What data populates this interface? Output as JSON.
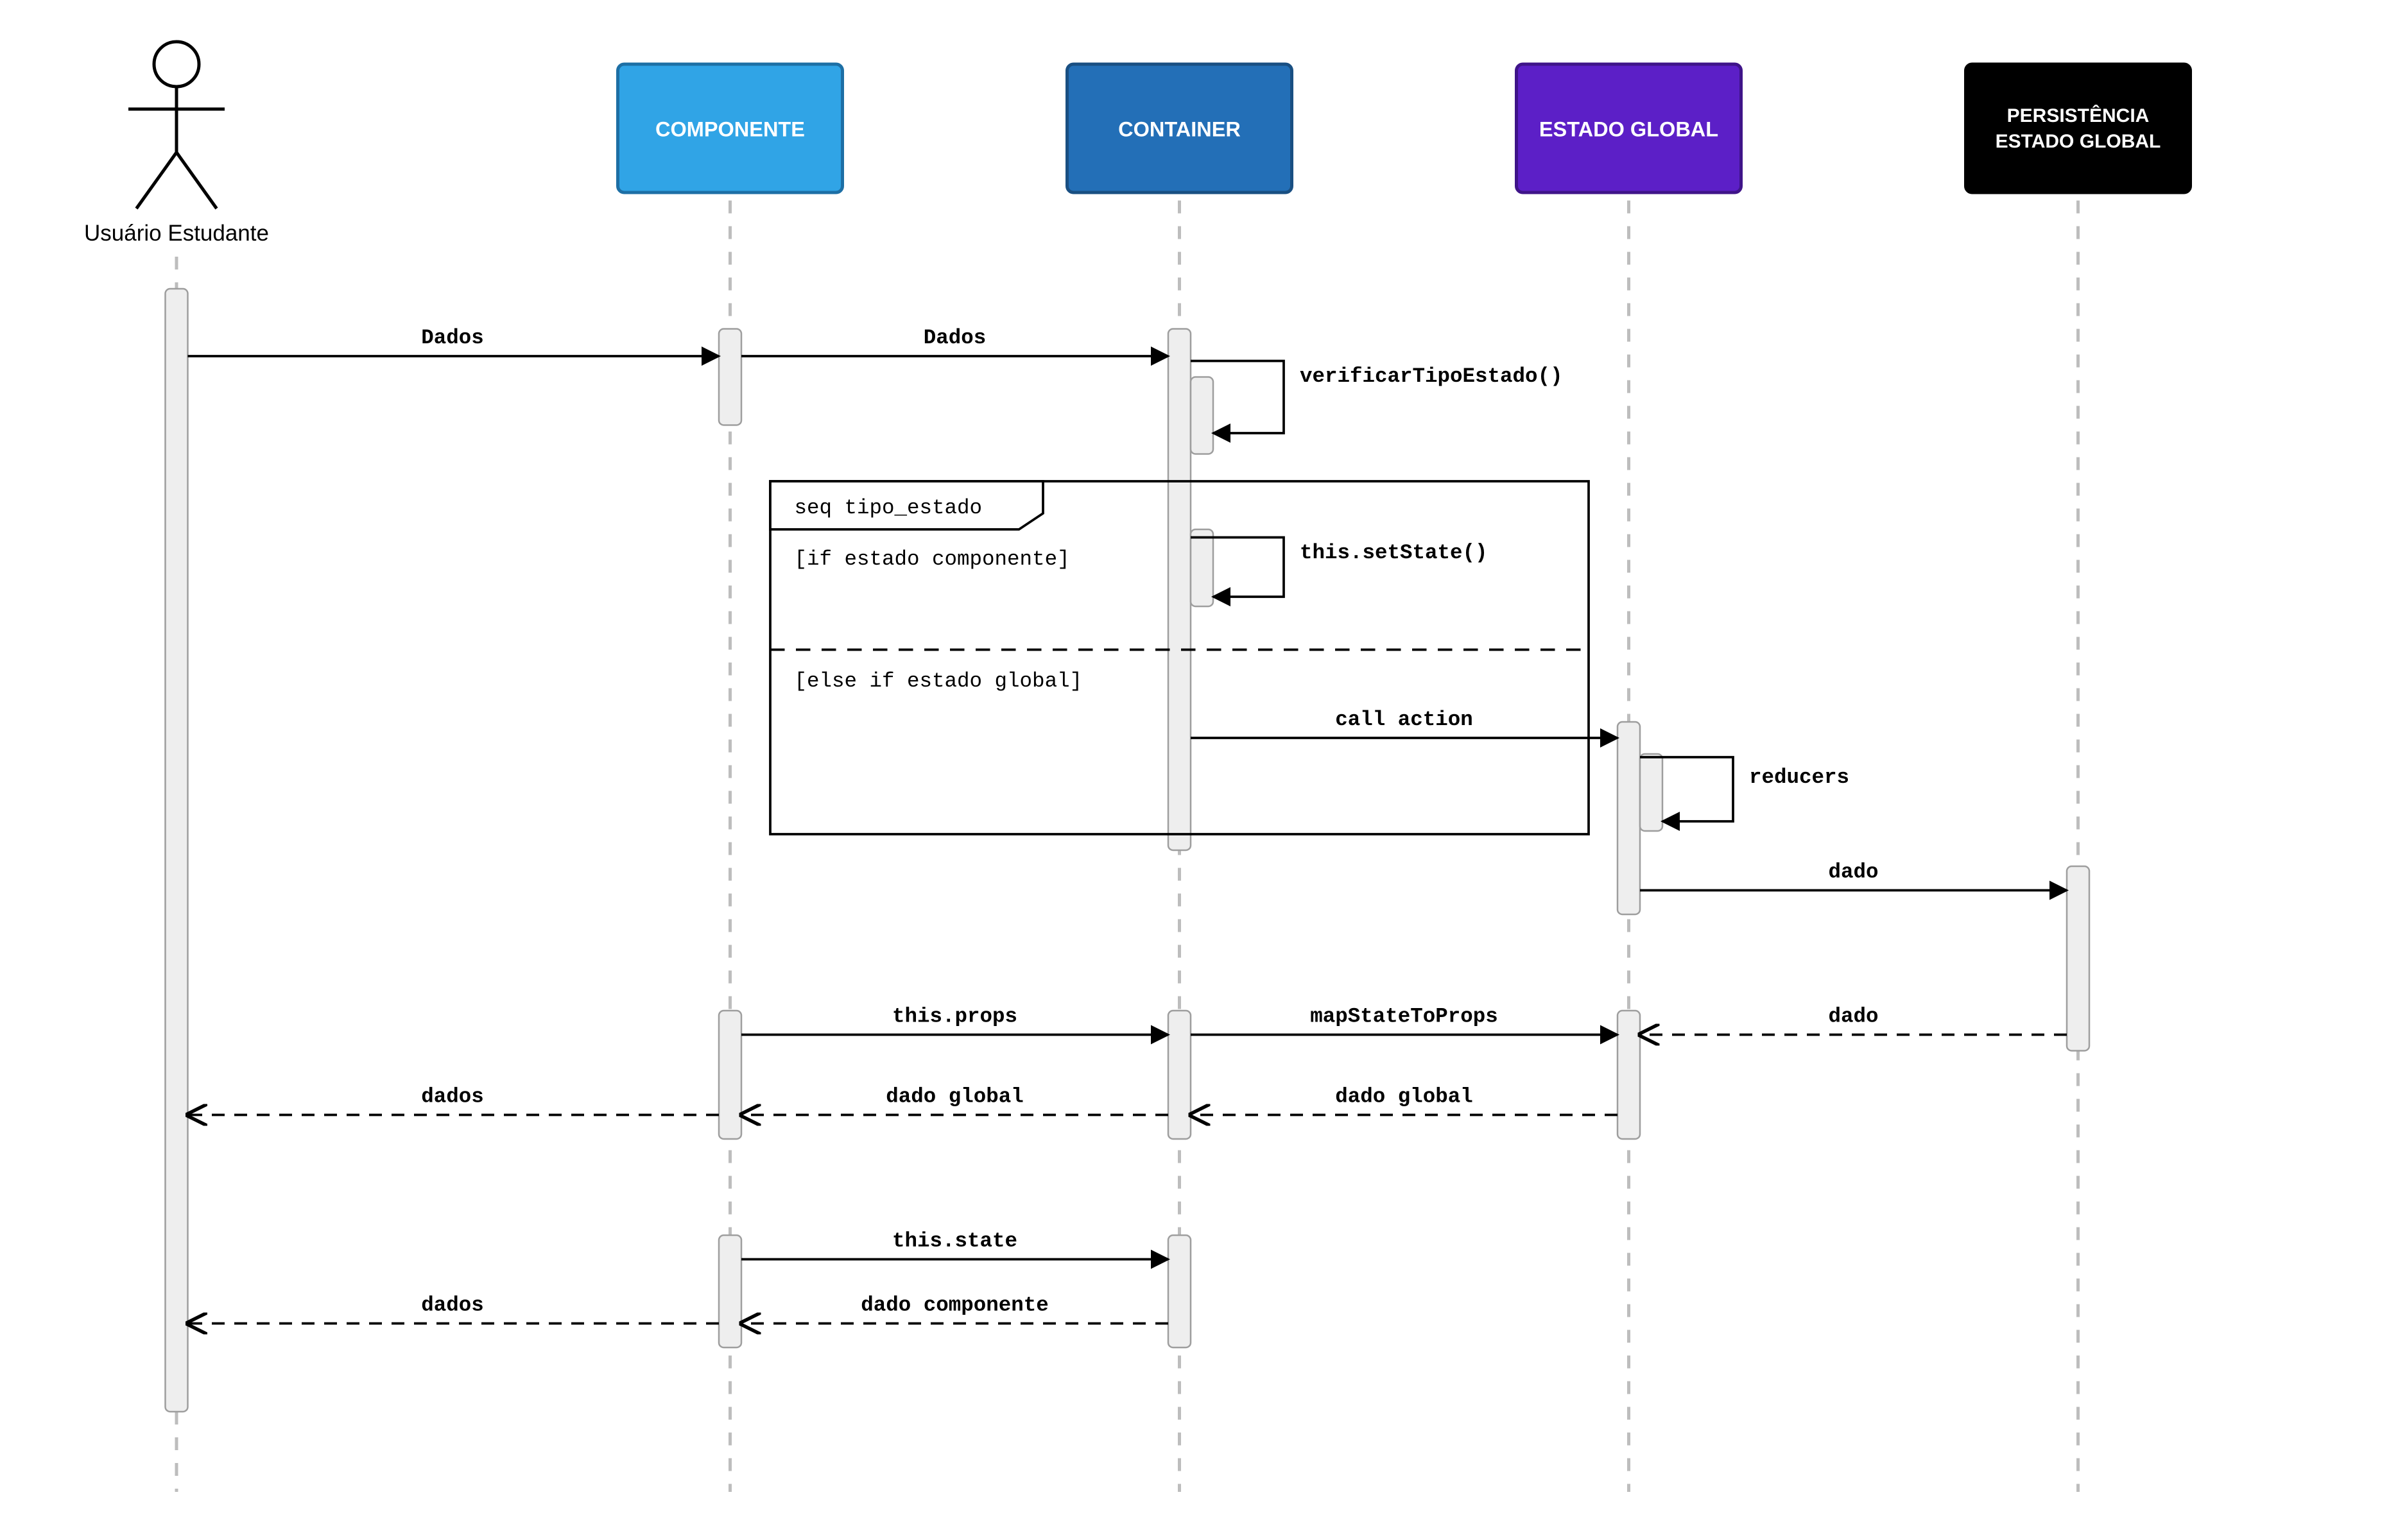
{
  "actor": {
    "label": "Usuário Estudante"
  },
  "lifelines": {
    "componente": {
      "label": "COMPONENTE",
      "fill": "#30a4e6",
      "stroke": "#1d6fa5",
      "text": "#ffffff"
    },
    "container": {
      "label": "CONTAINER",
      "fill": "#236fb7",
      "stroke": "#194f82",
      "text": "#ffffff"
    },
    "estadoGlobal": {
      "label": "ESTADO GLOBAL",
      "fill": "#5c1fc7",
      "stroke": "#3f1489",
      "text": "#ffffff"
    },
    "persistencia": {
      "label1": "PERSISTÊNCIA",
      "label2": "ESTADO GLOBAL",
      "fill": "#000000",
      "stroke": "#000000",
      "text": "#ffffff"
    }
  },
  "fragment": {
    "tag": "seq tipo_estado",
    "guard1": "[if estado componente]",
    "guard2": "[else if estado global]"
  },
  "messages": {
    "m1": "Dados",
    "m2": "Dados",
    "m3": "verificarTipoEstado()",
    "m4": "this.setState()",
    "m5": "call action",
    "m6": "reducers",
    "m7": "dado",
    "m8": "this.props",
    "m9": "mapStateToProps",
    "m10": "dado",
    "m11": "dados",
    "m12": "dado global",
    "m13": "dado global",
    "m14": "this.state",
    "m15": "dados",
    "m16": "dado componente"
  }
}
